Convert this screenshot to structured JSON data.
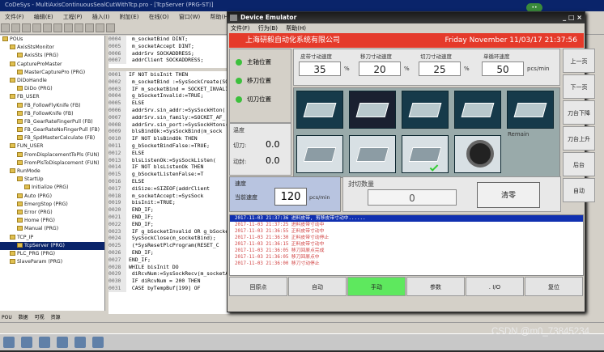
{
  "ide": {
    "title": "CoDeSys - MultiAxisContinuousSealCutWithTcp.pro - [TcpServer (PRG-ST)]",
    "menu": [
      "文件(F)",
      "编辑(E)",
      "工程(P)",
      "插入(I)",
      "附加(E)",
      "在线(O)",
      "窗口(W)",
      "帮助(H)"
    ],
    "tree": [
      {
        "label": "POUs",
        "indent": 0
      },
      {
        "label": "AxisStsMonitor",
        "indent": 1
      },
      {
        "label": "AxisSts (PRG)",
        "indent": 2
      },
      {
        "label": "CaptureProMaster",
        "indent": 1
      },
      {
        "label": "MasterCapturePro (PRG)",
        "indent": 2
      },
      {
        "label": "DiDoHandle",
        "indent": 1
      },
      {
        "label": "DiDo (PRG)",
        "indent": 2
      },
      {
        "label": "FB_USER",
        "indent": 1
      },
      {
        "label": "FB_FollowFlyKnife (FB)",
        "indent": 2
      },
      {
        "label": "FB_FollowKnife (FB)",
        "indent": 2
      },
      {
        "label": "FB_GearRateFingerPull (FB)",
        "indent": 2
      },
      {
        "label": "FB_GearRateNoFingerPull (FB)",
        "indent": 2
      },
      {
        "label": "FB_SpdMasterCalculate (FB)",
        "indent": 2
      },
      {
        "label": "FUN_USER",
        "indent": 1
      },
      {
        "label": "FromDisplacementToPls (FUN)",
        "indent": 2
      },
      {
        "label": "FromPlsToDisplacement (FUN)",
        "indent": 2
      },
      {
        "label": "RunMode",
        "indent": 1
      },
      {
        "label": "StartUp",
        "indent": 2
      },
      {
        "label": "Initialize (PRG)",
        "indent": 3
      },
      {
        "label": "Auto (PRG)",
        "indent": 2
      },
      {
        "label": "EmergStop (PRG)",
        "indent": 2
      },
      {
        "label": "Error (PRG)",
        "indent": 2
      },
      {
        "label": "Home (PRG)",
        "indent": 2
      },
      {
        "label": "Manual (PRG)",
        "indent": 2
      },
      {
        "label": "TCP_IP",
        "indent": 1
      },
      {
        "label": "TcpServer (PRG)",
        "indent": 2,
        "selected": true
      },
      {
        "label": "PLC_PRG (PRG)",
        "indent": 1
      },
      {
        "label": "SlaveParam (PRG)",
        "indent": 1
      }
    ],
    "bottom_tabs": [
      "POU",
      "数据",
      "可视",
      "资源"
    ],
    "decl": [
      {
        "ln": "0004",
        "text": "   m_socketBind       DINT;"
      },
      {
        "ln": "0005",
        "text": "   m_socketAccept     DINT;"
      },
      {
        "ln": "0006",
        "text": "   addrSrv            SOCKADDRESS;"
      },
      {
        "ln": "0007",
        "text": "   addrClient         SOCKADDRESS;"
      }
    ],
    "code": [
      {
        "ln": "0001",
        "text": "IF NOT bisInit THEN"
      },
      {
        "ln": "0002",
        "text": "  m_socketBind :=SysSockCreate(SOCKET_"
      },
      {
        "ln": "0003",
        "text": "  IF m_socketBind = SOCKET_INVALID T"
      },
      {
        "ln": "0004",
        "text": "     g_bSocketInvalid:=TRUE;"
      },
      {
        "ln": "0005",
        "text": "  ELSE"
      },
      {
        "ln": "0006",
        "text": "     addrSrv.sin_addr:=SysSockHton("
      },
      {
        "ln": "0007",
        "text": "     addrSrv.sin_family:=SOCKET_AF_"
      },
      {
        "ln": "0008",
        "text": "     addrSrv.sin_port:=SysSockHtons("
      },
      {
        "ln": "0009",
        "text": "     blsBindOk:=SysSockBind(m_sock"
      },
      {
        "ln": "0010",
        "text": "     IF NOT blsBindOk THEN"
      },
      {
        "ln": "0011",
        "text": "        g_bSocketBindFalse:=TRUE;"
      },
      {
        "ln": "0012",
        "text": "     ELSE"
      },
      {
        "ln": "0013",
        "text": "        blsListenOk:=SysSockListen("
      },
      {
        "ln": "0014",
        "text": "        IF NOT blsListenOk THEN"
      },
      {
        "ln": "0015",
        "text": "           g_bSocketListenFalse:=T"
      },
      {
        "ln": "0016",
        "text": "        ELSE"
      },
      {
        "ln": "0017",
        "text": "           diSize:=SIZEOF(addrClient"
      },
      {
        "ln": "0018",
        "text": "           m_socketAccept:=SysSock"
      },
      {
        "ln": "0019",
        "text": "           bisInit:=TRUE;"
      },
      {
        "ln": "0020",
        "text": "        END_IF;"
      },
      {
        "ln": "0021",
        "text": "     END_IF;"
      },
      {
        "ln": "0022",
        "text": "  END_IF;"
      },
      {
        "ln": "0023",
        "text": "  IF g_bSocketInvalid OR g_bSocketBin"
      },
      {
        "ln": "0024",
        "text": "     SysSockClose(m_socketBind);"
      },
      {
        "ln": "0025",
        "text": "     (*SysResetPlcProgram(RESET_C"
      },
      {
        "ln": "0026",
        "text": "  END_IF;"
      },
      {
        "ln": "0027",
        "text": "END_IF;"
      },
      {
        "ln": "0028",
        "text": "WHILE bisInit DO"
      },
      {
        "ln": "0029",
        "text": "  diRcvNum:=SysSockRecv(m_socketA"
      },
      {
        "ln": "0030",
        "text": "  IF diRcvNum = 200 THEN"
      },
      {
        "ln": "0031",
        "text": "     CASE byTempBuf[199] OF"
      }
    ],
    "watermark": "CSDN @m0_73845234"
  },
  "emu": {
    "title": "Device Emulator",
    "menu": [
      "文件(F)",
      "行为(B)",
      "帮助(H)"
    ],
    "company": "上海研毅自动化系统有限公司",
    "datetime": "Friday November 11/03/17 21:37:56",
    "indicators": [
      "主轴位置",
      "移刀位置",
      "切刀位置"
    ],
    "speeds": [
      {
        "label": "皮带寸动速度",
        "value": "35",
        "unit": "%"
      },
      {
        "label": "移刀寸动速度",
        "value": "20",
        "unit": "%"
      },
      {
        "label": "切刀寸动速度",
        "value": "25",
        "unit": "%"
      },
      {
        "label": "单循环速度",
        "value": "50",
        "unit": "pcs/min"
      }
    ],
    "right_buttons": [
      "上一页",
      "下一页",
      "刀台下降",
      "刀台上升",
      "后台",
      "自动"
    ],
    "remain_label": "Remain",
    "force": {
      "title": "温度",
      "cut_label": "切刀:",
      "cut_value": "0.0",
      "mid_label": "动封:",
      "mid_value": "0.0"
    },
    "speed": {
      "title": "速度",
      "label": "当前速度",
      "value": "120",
      "unit": "pcs/min"
    },
    "count": {
      "title": "封切数量",
      "value": "0",
      "clear": "清零"
    },
    "log": [
      "2017-11-03  21:37:36    进料皮带,   剪移皮带寸动中......",
      "2017-11-03  21:37:25    进料皮带寸动中",
      "2017-11-03  21:36:55    正料皮带寸动中",
      "2017-11-03  21:36:30    正料皮带寸动停止",
      "2017-11-03  21:36:15    正料皮带寸动中",
      "2017-11-03  21:36:05    移刀回原点完成",
      "2017-11-03  21:36:05    移刀回原点中",
      "2017-11-03  21:36:00    移刀寸动停止"
    ],
    "bottom_buttons": [
      "回原点",
      "自动",
      "手动",
      "参数",
      ". I/O",
      "复位"
    ],
    "active_bottom": 2
  },
  "colors": {
    "header": "#e53a2a",
    "indicator": "#3cc03c",
    "manual_active": "#5ee85e",
    "log_highlight": "#1030b0"
  }
}
